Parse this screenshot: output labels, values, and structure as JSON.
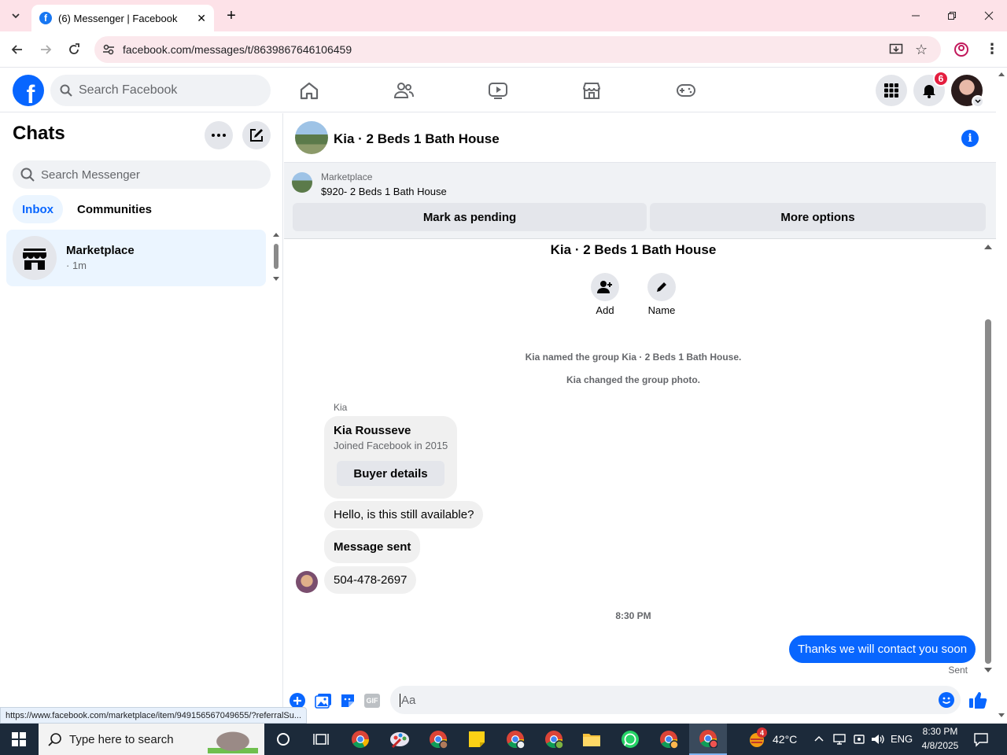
{
  "browser": {
    "tab_title": "(6) Messenger | Facebook",
    "url": "facebook.com/messages/t/8639867646106459",
    "status_url": "https://www.facebook.com/marketplace/item/949156567049655/?referralSu..."
  },
  "fb_header": {
    "search_placeholder": "Search Facebook",
    "notification_count": "6"
  },
  "sidebar": {
    "title": "Chats",
    "search_placeholder": "Search Messenger",
    "tabs": [
      "Inbox",
      "Communities"
    ],
    "chats": [
      {
        "name": "Marketplace",
        "meta": "· 1m"
      }
    ]
  },
  "chat": {
    "title": "Kia · 2 Beds 1 Bath House",
    "marketplace": {
      "label": "Marketplace",
      "listing": "$920- 2 Beds 1 Bath House",
      "pending_button": "Mark as pending",
      "options_button": "More options"
    },
    "group_header": {
      "title": "Kia · 2 Beds 1 Bath House",
      "add_label": "Add",
      "name_label": "Name"
    },
    "system_messages": [
      "Kia named the group Kia · 2 Beds 1 Bath House.",
      "Kia changed the group photo."
    ],
    "sender": "Kia",
    "buyer_card": {
      "name": "Kia Rousseve",
      "joined": "Joined Facebook in 2015",
      "button": "Buyer details"
    },
    "messages_in": [
      "Hello, is this still available?",
      "Message sent",
      "504-478-2697"
    ],
    "timestamp": "8:30 PM",
    "message_out": "Thanks we will contact you soon",
    "sent_status": "Sent",
    "composer_placeholder": "Aa",
    "composer_icons": [
      "plus-icon",
      "photo-icon",
      "sticker-icon",
      "gif-icon",
      "emoji-icon",
      "like-icon"
    ],
    "gif_text": "GIF"
  },
  "taskbar": {
    "search_placeholder": "Type here to search",
    "weather": "42°C",
    "weather_badge": "4",
    "language": "ENG",
    "time": "8:30 PM",
    "date": "4/8/2025"
  },
  "colors": {
    "accent": "#0866ff",
    "tabbar": "#fde2e8",
    "notification_badge": "#e41e3f",
    "taskbar": "#1c2a3a"
  }
}
